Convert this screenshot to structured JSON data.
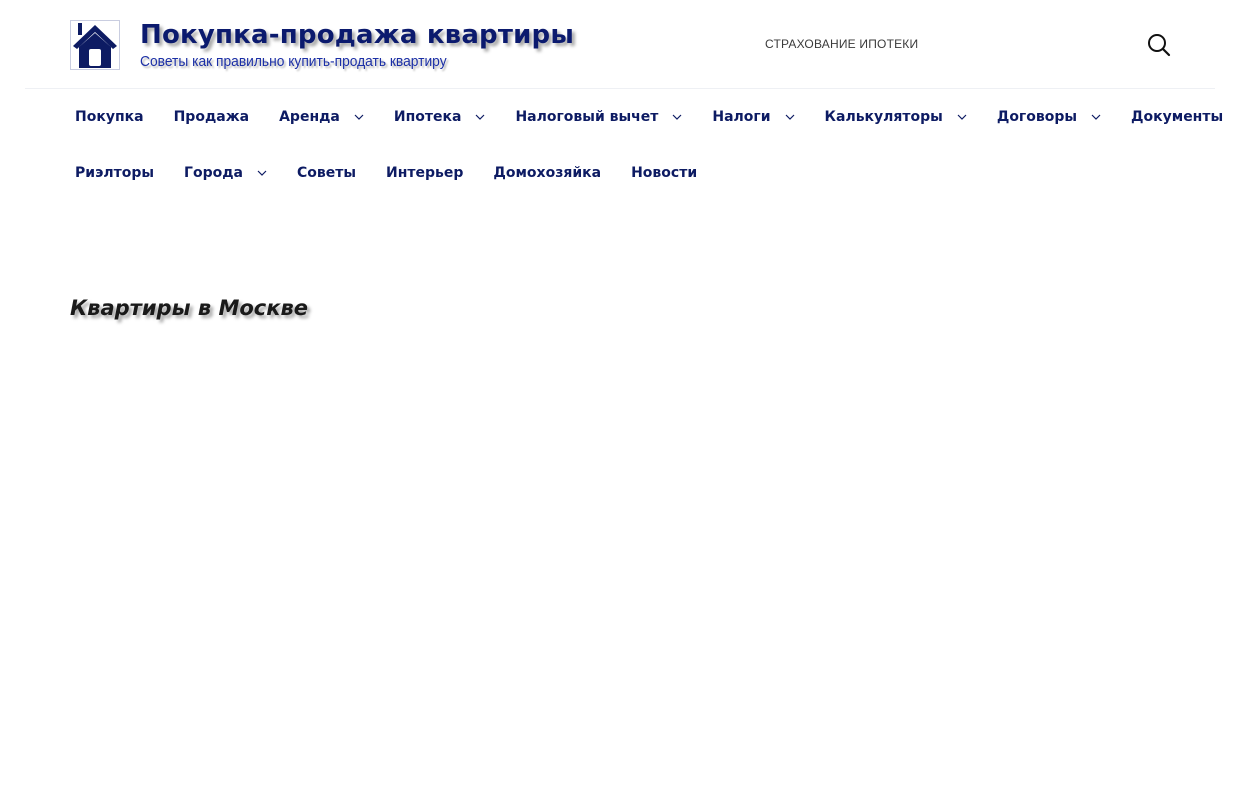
{
  "site": {
    "title": "Покупка-продажа квартиры",
    "subtitle": "Советы как правильно купить-продать квартиру",
    "logo_icon": "house-icon",
    "brand_color": "#0d1b63"
  },
  "header": {
    "top_link": "СТРАХОВАНИЕ ИПОТЕКИ",
    "search_icon": "search-icon"
  },
  "nav": {
    "row1": [
      {
        "label": "Покупка",
        "dropdown": false
      },
      {
        "label": "Продажа",
        "dropdown": false
      },
      {
        "label": "Аренда",
        "dropdown": true
      },
      {
        "label": "Ипотека",
        "dropdown": true
      },
      {
        "label": "Налоговый вычет",
        "dropdown": true
      },
      {
        "label": "Налоги",
        "dropdown": true
      },
      {
        "label": "Калькуляторы",
        "dropdown": true
      },
      {
        "label": "Договоры",
        "dropdown": true
      },
      {
        "label": "Документы",
        "dropdown": false
      }
    ],
    "row2": [
      {
        "label": "Риэлторы",
        "dropdown": false
      },
      {
        "label": "Города",
        "dropdown": true
      },
      {
        "label": "Советы",
        "dropdown": false
      },
      {
        "label": "Интерьер",
        "dropdown": false
      },
      {
        "label": "Домохозяйка",
        "dropdown": false
      },
      {
        "label": "Новости",
        "dropdown": false
      }
    ]
  },
  "main": {
    "heading": "Квартиры в Москве"
  }
}
